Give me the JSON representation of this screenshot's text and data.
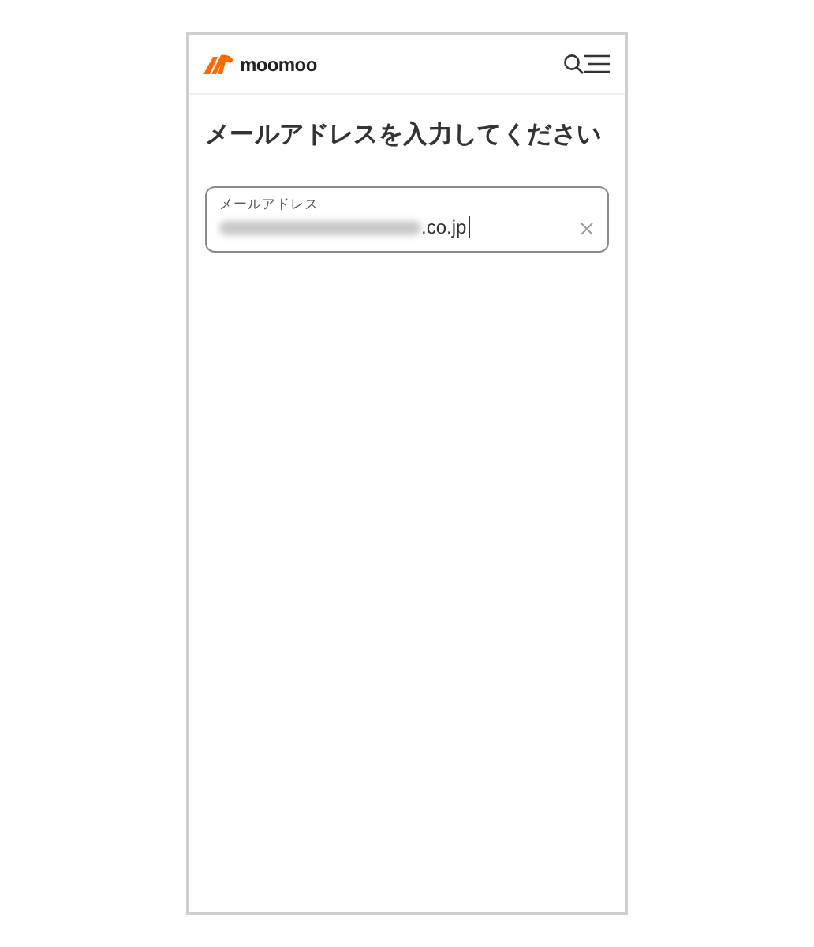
{
  "header": {
    "logo_text": "moomoo"
  },
  "title": "メールアドレスを入力してください",
  "email_field": {
    "label": "メールアドレス",
    "value": ".co.jp",
    "redacted_prefix": true,
    "focused": true
  }
}
